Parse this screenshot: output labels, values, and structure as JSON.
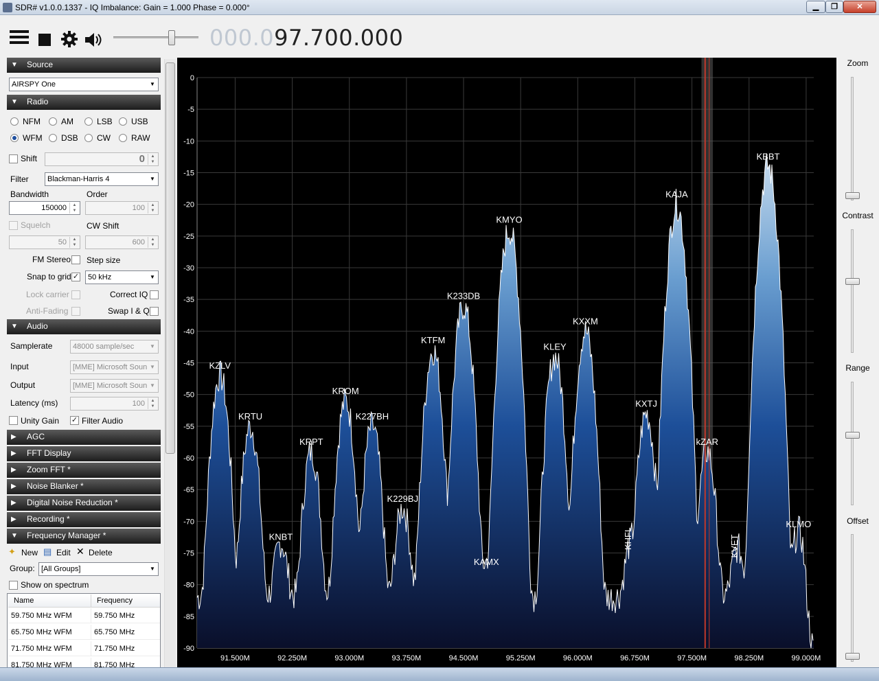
{
  "window": {
    "title": "SDR# v1.0.0.1337 - IQ Imbalance: Gain = 1.000 Phase = 0.000°",
    "minimize": "▁",
    "maximize": "❐",
    "close": "✕"
  },
  "frequency": {
    "dim": "000.0",
    "value": "97.700.000"
  },
  "volume": 0.7,
  "source": {
    "header": "Source",
    "device": "AIRSPY One"
  },
  "radio": {
    "header": "Radio",
    "modes": [
      {
        "label": "NFM",
        "selected": false
      },
      {
        "label": "AM",
        "selected": false
      },
      {
        "label": "LSB",
        "selected": false
      },
      {
        "label": "USB",
        "selected": false
      },
      {
        "label": "WFM",
        "selected": true
      },
      {
        "label": "DSB",
        "selected": false
      },
      {
        "label": "CW",
        "selected": false
      },
      {
        "label": "RAW",
        "selected": false
      }
    ],
    "shift_label": "Shift",
    "shift_value": "0",
    "filter_label": "Filter",
    "filter_value": "Blackman-Harris 4",
    "bandwidth_label": "Bandwidth",
    "bandwidth_value": "150000",
    "order_label": "Order",
    "order_value": "100",
    "squelch_label": "Squelch",
    "squelch_value": "50",
    "cwshift_label": "CW Shift",
    "cwshift_value": "600",
    "fmstereo_label": "FM Stereo",
    "stepsize_label": "Step size",
    "stepsize_value": "50 kHz",
    "snap_label": "Snap to grid",
    "lock_label": "Lock carrier",
    "correctiq_label": "Correct IQ",
    "antifading_label": "Anti-Fading",
    "swapiq_label": "Swap I & Q",
    "checks": {
      "✓": "✓"
    }
  },
  "audio": {
    "header": "Audio",
    "samplerate_label": "Samplerate",
    "samplerate_value": "48000 sample/sec",
    "input_label": "Input",
    "input_value": "[MME] Microsoft Soun",
    "output_label": "Output",
    "output_value": "[MME] Microsoft Soun",
    "latency_label": "Latency (ms)",
    "latency_value": "100",
    "unity_label": "Unity Gain",
    "filteraudio_label": "Filter Audio"
  },
  "collapsed": [
    "AGC",
    "FFT Display",
    "Zoom FFT *",
    "Noise Blanker *",
    "Digital Noise Reduction *",
    "Recording *"
  ],
  "fm": {
    "header": "Frequency Manager *",
    "new": "New",
    "edit": "Edit",
    "delete": "Delete",
    "group_label": "Group:",
    "group_value": "[All Groups]",
    "show_label": "Show on spectrum",
    "col_name": "Name",
    "col_freq": "Frequency",
    "rows": [
      {
        "name": "59.750 MHz WFM",
        "freq": "59.750 MHz"
      },
      {
        "name": "65.750 MHz WFM",
        "freq": "65.750 MHz"
      },
      {
        "name": "71.750 MHz WFM",
        "freq": "71.750 MHz"
      },
      {
        "name": "81.750 MHz WFM",
        "freq": "81.750 MHz"
      }
    ]
  },
  "right": {
    "zoom": "Zoom",
    "contrast": "Contrast",
    "range": "Range",
    "offset": "Offset"
  },
  "chart_data": {
    "type": "area",
    "xlabels": [
      "91.500M",
      "92.250M",
      "93.000M",
      "93.750M",
      "94.500M",
      "95.250M",
      "96.000M",
      "96.750M",
      "97.500M",
      "98.250M",
      "99.000M"
    ],
    "yticks": [
      0,
      -5,
      -10,
      -15,
      -20,
      -25,
      -30,
      -35,
      -40,
      -45,
      -50,
      -55,
      -60,
      -65,
      -70,
      -75,
      -80,
      -85,
      -90
    ],
    "ylim": [
      -90,
      0
    ],
    "xlim": [
      91.0,
      99.1
    ],
    "noise_floor": -82,
    "tuned_mhz": 97.7,
    "filter_bw_mhz": 0.15,
    "stations": [
      {
        "name": "KZLV",
        "mhz": 91.3,
        "db": -47
      },
      {
        "name": "KRTU",
        "mhz": 91.7,
        "db": -55
      },
      {
        "name": "KNBT",
        "mhz": 92.1,
        "db": -74
      },
      {
        "name": "KRPT",
        "mhz": 92.5,
        "db": -59
      },
      {
        "name": "KROM",
        "mhz": 92.95,
        "db": -51
      },
      {
        "name": "K227BH",
        "mhz": 93.3,
        "db": -55
      },
      {
        "name": "K229BJ",
        "mhz": 93.7,
        "db": -68
      },
      {
        "name": "KTFM",
        "mhz": 94.1,
        "db": -43
      },
      {
        "name": "K233DB",
        "mhz": 94.5,
        "db": -36
      },
      {
        "name": "KAMX",
        "mhz": 94.8,
        "db": -78
      },
      {
        "name": "KMYO",
        "mhz": 95.1,
        "db": -24
      },
      {
        "name": "KLEY",
        "mhz": 95.7,
        "db": -44
      },
      {
        "name": "KXXM",
        "mhz": 96.1,
        "db": -40
      },
      {
        "name": "KHFI",
        "mhz": 96.7,
        "db": -74
      },
      {
        "name": "KXTJ",
        "mhz": 96.9,
        "db": -53
      },
      {
        "name": "KAJA",
        "mhz": 97.3,
        "db": -20
      },
      {
        "name": "kZAR",
        "mhz": 97.7,
        "db": -59
      },
      {
        "name": "KVET",
        "mhz": 98.1,
        "db": -75
      },
      {
        "name": "KBBT",
        "mhz": 98.5,
        "db": -14
      },
      {
        "name": "KLMO",
        "mhz": 98.9,
        "db": -72
      }
    ]
  }
}
